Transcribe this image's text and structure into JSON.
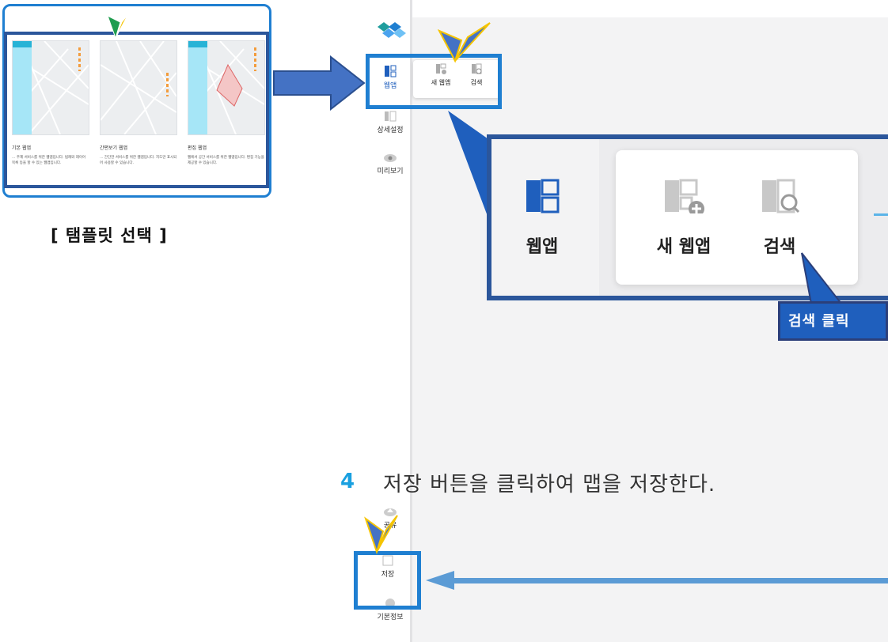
{
  "template_panel": {
    "caption": "[ 탬플릿 선택 ]",
    "cards": [
      {
        "name": "기본 웹앱",
        "desc": "… 주제 서비스를 위한 웹앱입니다. 범례와 레이어 목록 등을 할 수 있는 웹앱입니다."
      },
      {
        "name": "간편보기 웹앱",
        "desc": "… 간단한 서비스를 위한 웹앱입니다. 지도만 표시되어 사용할 수 있습니다."
      },
      {
        "name": "편집 웹앱",
        "desc": "웹에서 공간 서비스를 위한 웹앱입니다. 편집 기능을 제공할 수 있습니다."
      }
    ]
  },
  "sidebar": {
    "items": [
      {
        "label": "웹앱",
        "icon": "webapp-icon"
      },
      {
        "label": "상세설정",
        "icon": "settings-icon"
      },
      {
        "label": "미리보기",
        "icon": "eye-icon"
      },
      {
        "label": "공유",
        "icon": "cloud-upload-icon"
      },
      {
        "label": "저장",
        "icon": "save-icon"
      },
      {
        "label": "기본정보",
        "icon": "info-icon"
      }
    ]
  },
  "webapp_panel": {
    "new_label": "새 웹앱",
    "search_label": "검색"
  },
  "zoom": {
    "webapp_label": "웹앱",
    "new_label": "새 웹앱",
    "search_label": "검색"
  },
  "tooltip": {
    "text": "검색 클릭"
  },
  "step": {
    "number": "4",
    "text": "저장 버튼을 클릭하여 맵을 저장한다."
  },
  "colors": {
    "accent": "#1f7fd1",
    "dark_blue": "#2b569b",
    "arrow_fill": "#4472c4",
    "step_number": "#1aa0e0",
    "cursor_yellow": "#f5c400"
  }
}
